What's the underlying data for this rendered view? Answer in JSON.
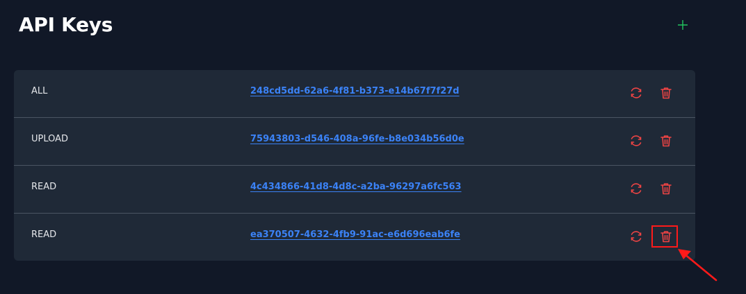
{
  "header": {
    "title": "API Keys",
    "add_icon": "plus-icon"
  },
  "keys": [
    {
      "scope": "ALL",
      "key": "248cd5dd-62a6-4f81-b373-e14b67f7f27d"
    },
    {
      "scope": "UPLOAD",
      "key": "75943803-d546-408a-96fe-b8e034b56d0e"
    },
    {
      "scope": "READ",
      "key": "4c434866-41d8-4d8c-a2ba-96297a6fc563"
    },
    {
      "scope": "READ",
      "key": "ea370507-4632-4fb9-91ac-e6d696eab6fe"
    }
  ],
  "icons": {
    "regenerate": "refresh-icon",
    "delete": "trash-icon"
  },
  "colors": {
    "background": "#111827",
    "card": "#1f2937",
    "link": "#3b82f6",
    "action": "#ef4444",
    "add": "#22c55e",
    "annotation": "#ff1a1a"
  }
}
